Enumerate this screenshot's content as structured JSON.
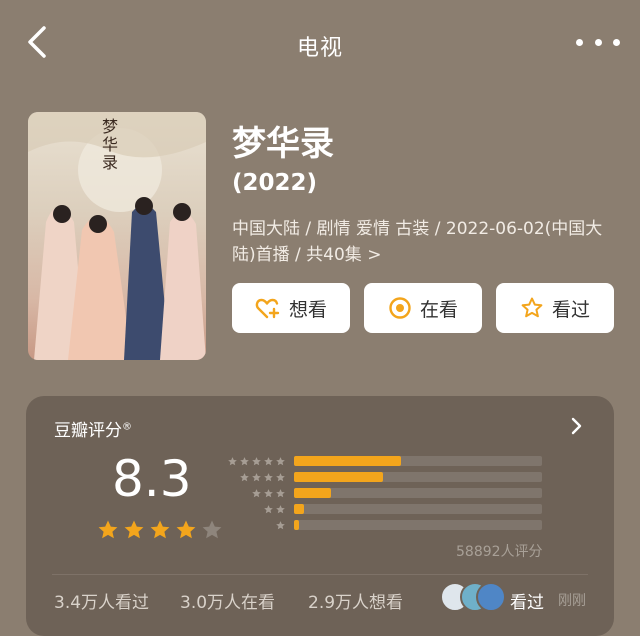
{
  "header": {
    "title": "电视"
  },
  "movie": {
    "title": "梦华录",
    "year": "(2022)",
    "meta": "中国大陆 / 剧情 爱情 古装 / 2022-06-02(中国大陆)首播 / 共40集 >",
    "poster_text": "梦华录"
  },
  "actions": {
    "want_label": "想看",
    "watching_label": "在看",
    "watched_label": "看过"
  },
  "rating": {
    "title": "豆瓣评分",
    "score": "8.3",
    "stars": 4,
    "distribution": [
      {
        "stars": 5,
        "fraction": 0.43
      },
      {
        "stars": 4,
        "fraction": 0.36
      },
      {
        "stars": 3,
        "fraction": 0.15
      },
      {
        "stars": 2,
        "fraction": 0.04
      },
      {
        "stars": 1,
        "fraction": 0.02
      }
    ],
    "count_text": "58892人评分"
  },
  "stats": {
    "watched": "3.4万人看过",
    "watching": "3.0万人在看",
    "want": "2.9万人想看",
    "friend_seen": "看过",
    "time": "刚刚"
  },
  "colors": {
    "background": "#8b7e70",
    "card": "#6e6257",
    "accent": "#f3a51c"
  },
  "icons": {
    "back": "chevron-left-icon",
    "more": "more-icon",
    "want": "heart-plus-icon",
    "watching": "circle-dot-icon",
    "watched": "star-outline-icon",
    "rating_arrow": "chevron-right-icon"
  }
}
